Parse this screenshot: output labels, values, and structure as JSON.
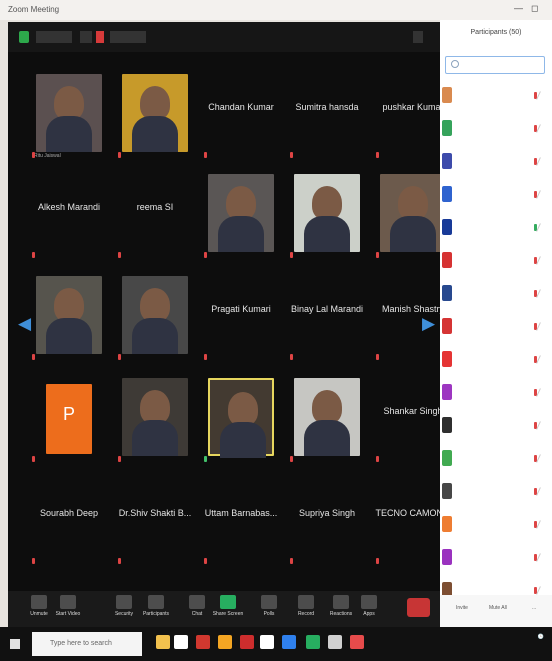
{
  "window": {
    "title": "Zoom Meeting"
  },
  "meeting": {
    "tiles": [
      {
        "key": "t1",
        "name": "",
        "caption": "Ritu Jaiswal",
        "mic": "muted",
        "video": true,
        "selected": false,
        "bg": "#5b5050"
      },
      {
        "key": "t2",
        "name": "",
        "caption": "",
        "mic": "muted",
        "video": true,
        "selected": false,
        "bg": "#c79a2a"
      },
      {
        "key": "t3",
        "name": "Chandan Kumar",
        "caption": "",
        "mic": "muted",
        "video": false,
        "selected": false,
        "bg": ""
      },
      {
        "key": "t4",
        "name": "Sumitra hansda",
        "caption": "",
        "mic": "muted",
        "video": false,
        "selected": false,
        "bg": ""
      },
      {
        "key": "t5",
        "name": "pushkar Kumar",
        "caption": "",
        "mic": "muted",
        "video": false,
        "selected": false,
        "bg": ""
      },
      {
        "key": "t6",
        "name": "Alkesh Marandi",
        "caption": "",
        "mic": "muted",
        "video": false,
        "selected": false,
        "bg": ""
      },
      {
        "key": "t7",
        "name": "reema SI",
        "caption": "",
        "mic": "muted",
        "video": false,
        "selected": false,
        "bg": ""
      },
      {
        "key": "t8",
        "name": "",
        "caption": "",
        "mic": "muted",
        "video": true,
        "selected": false,
        "bg": "#5a5655"
      },
      {
        "key": "t9",
        "name": "",
        "caption": "",
        "mic": "muted",
        "video": true,
        "selected": false,
        "bg": "#ccd0c9"
      },
      {
        "key": "t10",
        "name": "",
        "caption": "",
        "mic": "muted",
        "video": true,
        "selected": false,
        "bg": "#6c5a4c"
      },
      {
        "key": "t11",
        "name": "",
        "caption": "",
        "mic": "muted",
        "video": true,
        "selected": false,
        "bg": "#56544d"
      },
      {
        "key": "t12",
        "name": "",
        "caption": "",
        "mic": "muted",
        "video": true,
        "selected": false,
        "bg": "#484848"
      },
      {
        "key": "t13",
        "name": "Pragati Kumari",
        "caption": "",
        "mic": "muted",
        "video": false,
        "selected": false,
        "bg": ""
      },
      {
        "key": "t14",
        "name": "Binay Lal Marandi",
        "caption": "",
        "mic": "muted",
        "video": false,
        "selected": false,
        "bg": ""
      },
      {
        "key": "t15",
        "name": "Manish Shastry",
        "caption": "",
        "mic": "muted",
        "video": false,
        "selected": false,
        "bg": ""
      },
      {
        "key": "t16",
        "name": "P",
        "caption": "",
        "mic": "muted",
        "video": false,
        "selected": false,
        "bg": "#ed6d1c"
      },
      {
        "key": "t17",
        "name": "",
        "caption": "",
        "mic": "muted",
        "video": true,
        "selected": false,
        "bg": "#3e3a36"
      },
      {
        "key": "t18",
        "name": "",
        "caption": "",
        "mic": "active",
        "video": true,
        "selected": true,
        "bg": "#433a31"
      },
      {
        "key": "t19",
        "name": "",
        "caption": "",
        "mic": "muted",
        "video": true,
        "selected": false,
        "bg": "#c6c6c2"
      },
      {
        "key": "t20",
        "name": "Shankar Singh",
        "caption": "",
        "mic": "muted",
        "video": false,
        "selected": false,
        "bg": ""
      },
      {
        "key": "t21",
        "name": "Sourabh Deep",
        "caption": "",
        "mic": "muted",
        "video": false,
        "selected": false,
        "bg": ""
      },
      {
        "key": "t22",
        "name": "Dr.Shiv Shakti B...",
        "caption": "",
        "mic": "muted",
        "video": false,
        "selected": false,
        "bg": ""
      },
      {
        "key": "t23",
        "name": "Uttam Barnabas...",
        "caption": "",
        "mic": "muted",
        "video": false,
        "selected": false,
        "bg": ""
      },
      {
        "key": "t24",
        "name": "Supriya Singh",
        "caption": "",
        "mic": "muted",
        "video": false,
        "selected": false,
        "bg": ""
      },
      {
        "key": "t25",
        "name": "TECNO CAMON...",
        "caption": "",
        "mic": "muted",
        "video": false,
        "selected": false,
        "bg": ""
      }
    ],
    "toolbar": [
      {
        "label": "Unmute",
        "icon": "microphone-icon"
      },
      {
        "label": "Start Video",
        "icon": "video-camera-icon"
      },
      {
        "label": "Security",
        "icon": "shield-icon"
      },
      {
        "label": "Participants",
        "icon": "people-icon"
      },
      {
        "label": "Chat",
        "icon": "chat-icon"
      },
      {
        "label": "Share Screen",
        "icon": "share-screen-icon"
      },
      {
        "label": "Polls",
        "icon": "poll-icon"
      },
      {
        "label": "Record",
        "icon": "record-icon"
      },
      {
        "label": "Reactions",
        "icon": "reactions-icon"
      },
      {
        "label": "Apps",
        "icon": "apps-icon"
      }
    ]
  },
  "participants": {
    "title": "Participants (50)",
    "search_placeholder": "Search",
    "items": [
      {
        "color": "#d98a4f",
        "mic": "muted"
      },
      {
        "color": "#35a35b",
        "mic": "muted"
      },
      {
        "color": "#3d4bab",
        "mic": "muted"
      },
      {
        "color": "#2f63cf",
        "mic": "muted"
      },
      {
        "color": "#183a98",
        "mic": "active"
      },
      {
        "color": "#d63333",
        "mic": "muted"
      },
      {
        "color": "#28498f",
        "mic": "muted"
      },
      {
        "color": "#d53434",
        "mic": "muted"
      },
      {
        "color": "#e53434",
        "mic": "muted"
      },
      {
        "color": "#9d36c1",
        "mic": "muted"
      },
      {
        "color": "#2f2f2f",
        "mic": "muted"
      },
      {
        "color": "#41aa51",
        "mic": "muted"
      },
      {
        "color": "#474747",
        "mic": "muted"
      },
      {
        "color": "#ee7d32",
        "mic": "muted"
      },
      {
        "color": "#9a32bf",
        "mic": "muted"
      },
      {
        "color": "#7d4e32",
        "mic": "muted"
      }
    ],
    "footer": {
      "invite": "Invite",
      "mute_all": "Mute All"
    }
  },
  "taskbar": {
    "search_text": "Type here to search",
    "icons": [
      "#f2c14e",
      "#ffffff",
      "#d1382f",
      "#f5a623",
      "#cd2d2d",
      "#ffffff",
      "#2f80ed",
      "#27ae60",
      "#d0d0d0",
      "#e64b4b"
    ]
  }
}
